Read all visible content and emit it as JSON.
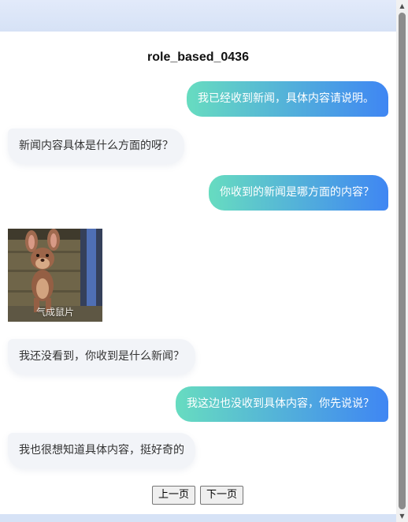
{
  "page": {
    "title": "role_based_0436"
  },
  "messages": [
    {
      "role": "user",
      "text": "我已经收到新闻，具体内容请说明。"
    },
    {
      "role": "bot",
      "text": "新闻内容具体是什么方面的呀？"
    },
    {
      "role": "user",
      "text": "你收到的新闻是哪方面的内容？"
    },
    {
      "role": "bot",
      "type": "sticker",
      "caption": "气成鼠片",
      "icon": "jerry-mouse-sticker"
    },
    {
      "role": "bot",
      "text": "我还没看到，你收到是什么新闻？"
    },
    {
      "role": "user",
      "text": "我这边也没收到具体内容，你先说说？"
    },
    {
      "role": "bot",
      "text": "我也很想知道具体内容，挺好奇的"
    }
  ],
  "pagination": {
    "prev_label": "上一页",
    "next_label": "下一页"
  },
  "colors": {
    "user_bubble_start": "#67dcc0",
    "user_bubble_end": "#3f86f3",
    "bot_bubble": "#f2f4f8",
    "background": "#dde6f5"
  }
}
